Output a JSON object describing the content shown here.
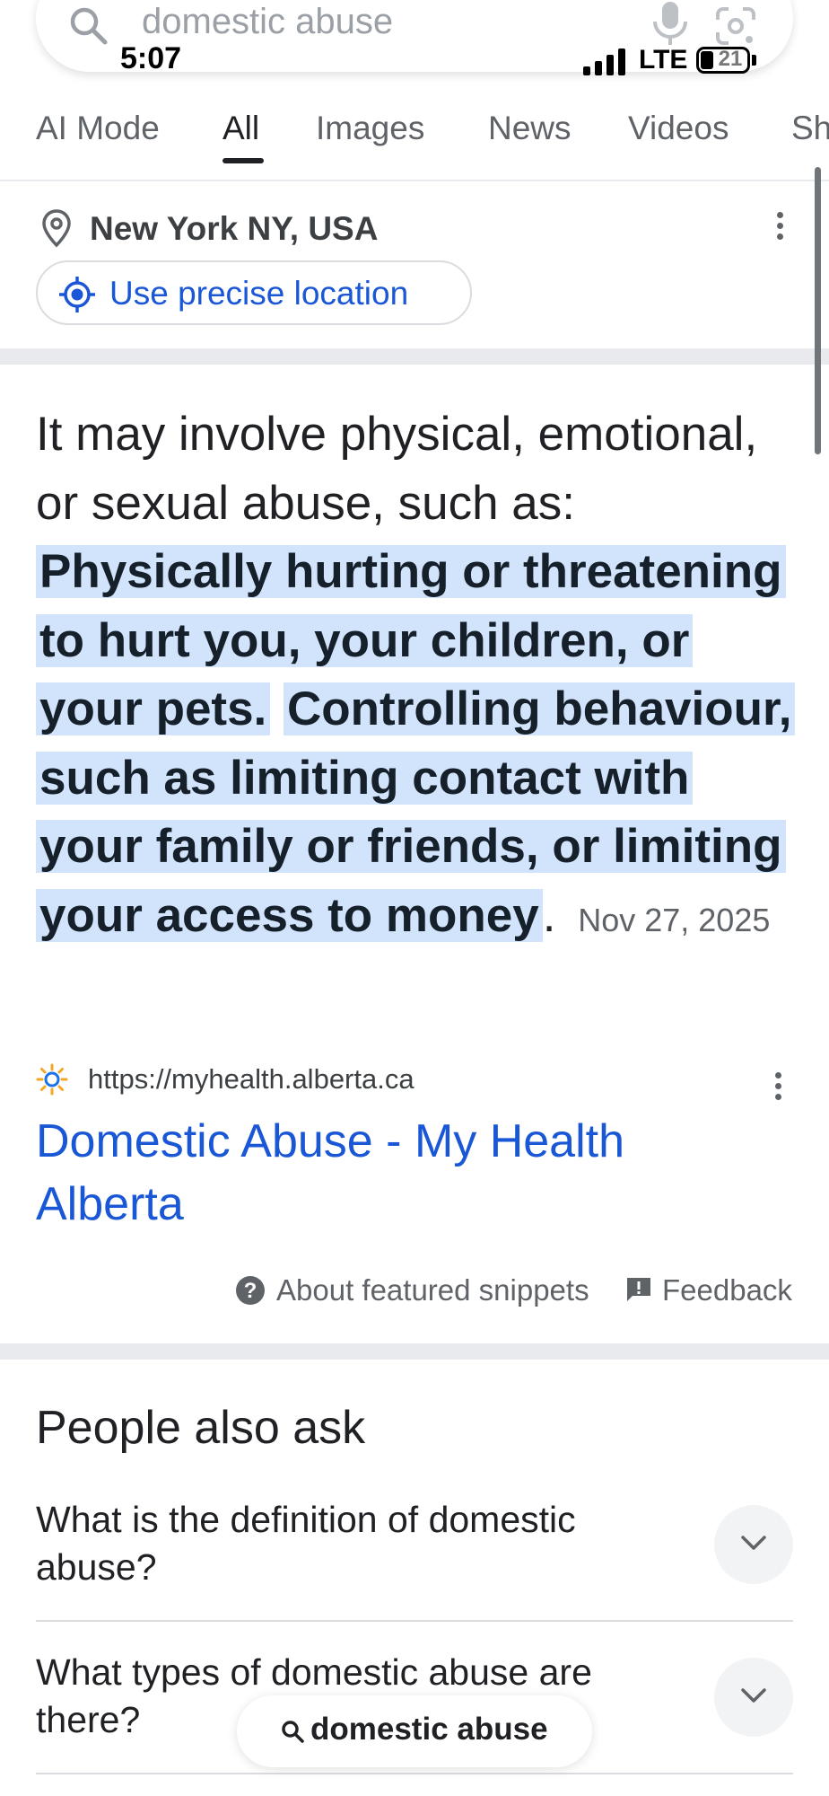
{
  "search": {
    "query": "domestic abuse"
  },
  "status_bar": {
    "time": "5:07",
    "network": "LTE",
    "battery": "21"
  },
  "tabs": [
    {
      "label": "AI Mode"
    },
    {
      "label": "All"
    },
    {
      "label": "Images"
    },
    {
      "label": "News"
    },
    {
      "label": "Videos"
    },
    {
      "label": "Sh"
    }
  ],
  "active_tab": "All",
  "location": {
    "name": "New York NY, USA",
    "precise_button": "Use precise location"
  },
  "snippet": {
    "intro": "It may involve physical, emotional, or sexual abuse, such as:",
    "highlight_1": "Physically hurting or threatening to hurt you, your children, or your pets.",
    "highlight_2": "Controlling behaviour, such as limiting contact with your family or friends, or limiting your access to money",
    "period": ".",
    "date": "Nov 27, 2025"
  },
  "source": {
    "url": "https://myhealth.alberta.ca",
    "title": "Domestic Abuse - My Health Alberta"
  },
  "snippet_footer": {
    "about": "About featured snippets",
    "feedback": "Feedback"
  },
  "people_also_ask": {
    "title": "People also ask",
    "questions": [
      "What is the definition of domestic abuse?",
      "What types of domestic abuse are there?"
    ]
  },
  "floating_search": {
    "label": "domestic abuse"
  },
  "colors": {
    "link": "#1a57d6",
    "highlight": "#d2e3fc",
    "divider": "#e8eaed"
  }
}
